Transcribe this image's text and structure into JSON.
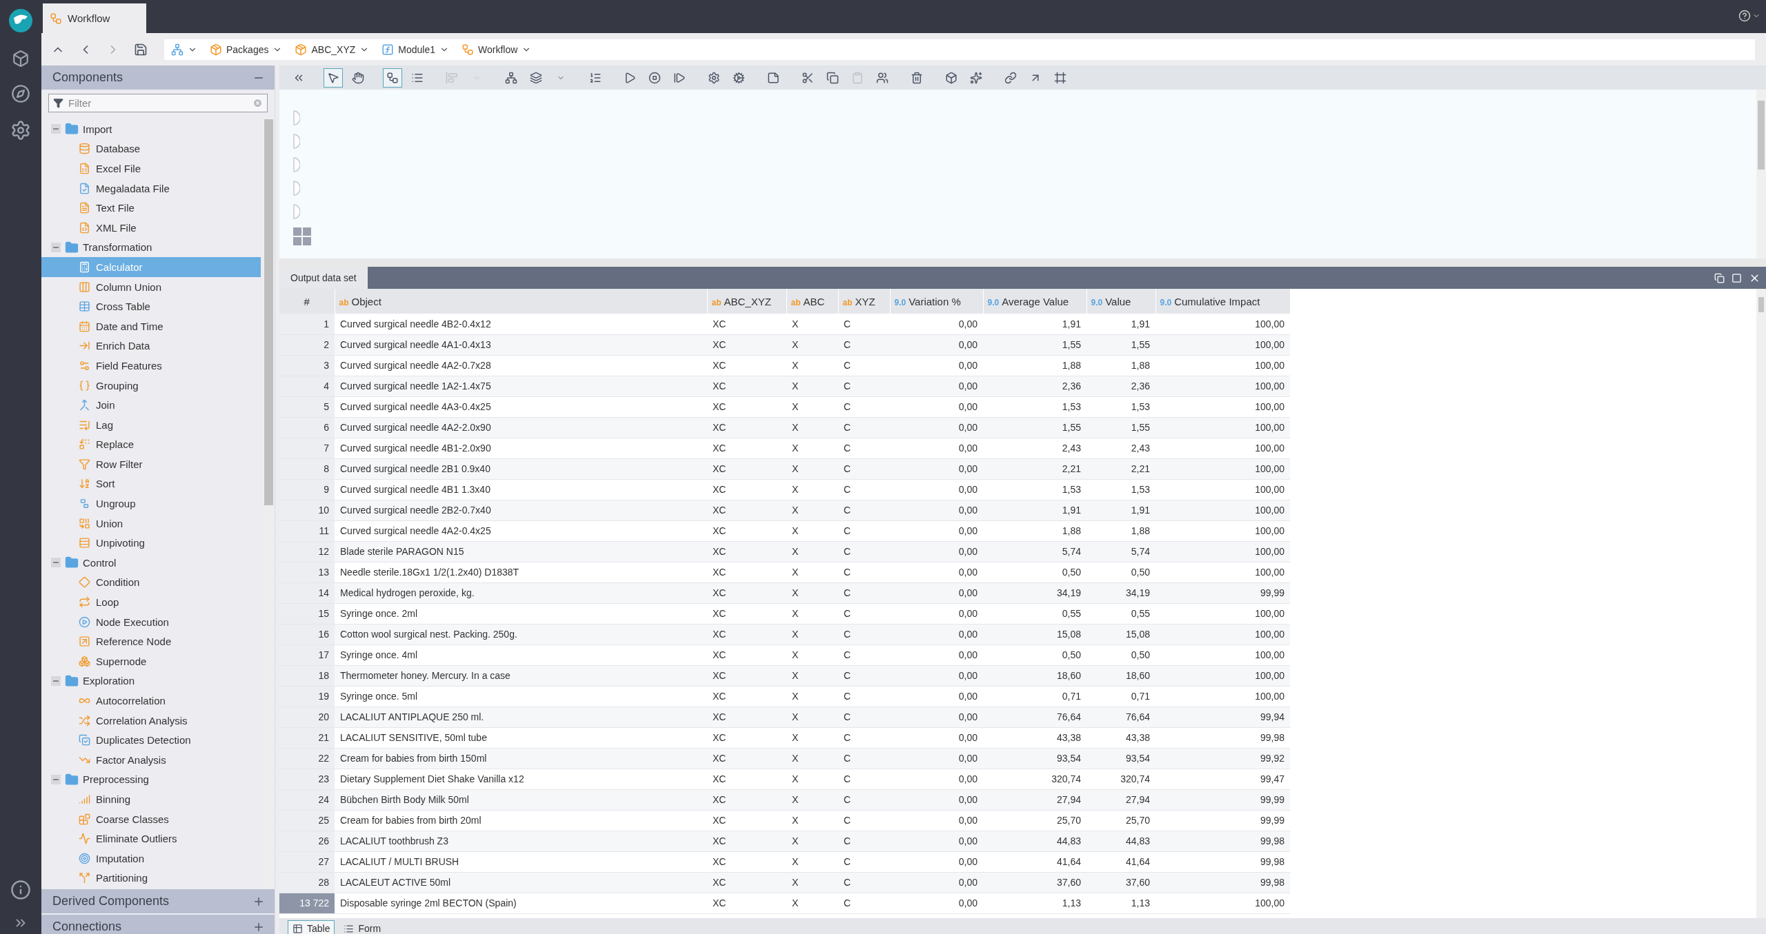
{
  "top_tab": {
    "label": "Workflow"
  },
  "breadcrumb": [
    {
      "label": "Packages"
    },
    {
      "label": "ABC_XYZ"
    },
    {
      "label": "Module1"
    },
    {
      "label": "Workflow"
    }
  ],
  "components": {
    "title": "Components",
    "expanded": true,
    "filter": {
      "placeholder": "Filter"
    },
    "tree": [
      {
        "label": "Import",
        "expanded": true,
        "selected": false,
        "children": [
          {
            "label": "Database",
            "selected": false
          },
          {
            "label": "Excel File",
            "selected": false
          },
          {
            "label": "Megaladata File",
            "selected": false
          },
          {
            "label": "Text File",
            "selected": false
          },
          {
            "label": "XML File",
            "selected": false
          }
        ]
      },
      {
        "label": "Transformation",
        "expanded": true,
        "selected": false,
        "children": [
          {
            "label": "Calculator",
            "selected": true
          },
          {
            "label": "Column Union",
            "selected": false
          },
          {
            "label": "Cross Table",
            "selected": false
          },
          {
            "label": "Date and Time",
            "selected": false
          },
          {
            "label": "Enrich Data",
            "selected": false
          },
          {
            "label": "Field Features",
            "selected": false
          },
          {
            "label": "Grouping",
            "selected": false
          },
          {
            "label": "Join",
            "selected": false
          },
          {
            "label": "Lag",
            "selected": false
          },
          {
            "label": "Replace",
            "selected": false
          },
          {
            "label": "Row Filter",
            "selected": false
          },
          {
            "label": "Sort",
            "selected": false
          },
          {
            "label": "Ungroup",
            "selected": false
          },
          {
            "label": "Union",
            "selected": false
          },
          {
            "label": "Unpivoting",
            "selected": false
          }
        ]
      },
      {
        "label": "Control",
        "expanded": true,
        "selected": false,
        "children": [
          {
            "label": "Condition",
            "selected": false
          },
          {
            "label": "Loop",
            "selected": false
          },
          {
            "label": "Node Execution",
            "selected": false
          },
          {
            "label": "Reference Node",
            "selected": false
          },
          {
            "label": "Supernode",
            "selected": false
          }
        ]
      },
      {
        "label": "Exploration",
        "expanded": true,
        "selected": false,
        "children": [
          {
            "label": "Autocorrelation",
            "selected": false
          },
          {
            "label": "Correlation Analysis",
            "selected": false
          },
          {
            "label": "Duplicates Detection",
            "selected": false
          },
          {
            "label": "Factor Analysis",
            "selected": false
          }
        ]
      },
      {
        "label": "Preprocessing",
        "expanded": true,
        "selected": false,
        "children": [
          {
            "label": "Binning",
            "selected": false
          },
          {
            "label": "Coarse Classes",
            "selected": false
          },
          {
            "label": "Eliminate Outliers",
            "selected": false
          },
          {
            "label": "Imputation",
            "selected": false
          },
          {
            "label": "Partitioning",
            "selected": false
          }
        ]
      }
    ]
  },
  "panels": [
    {
      "title": "Derived Components",
      "expanded": false
    },
    {
      "title": "Connections",
      "expanded": false
    }
  ],
  "toolbar": {
    "groups": [
      [
        {
          "selected": false,
          "disabled": false
        }
      ],
      [
        {
          "selected": true,
          "disabled": false
        },
        {
          "selected": false,
          "disabled": false
        }
      ],
      [
        {
          "selected": true,
          "disabled": false
        },
        {
          "selected": false,
          "disabled": false
        }
      ],
      [
        {
          "selected": false,
          "disabled": true
        },
        {
          "selected": false,
          "disabled": true
        }
      ],
      [
        {
          "selected": false,
          "disabled": false
        },
        {
          "selected": false,
          "disabled": false
        },
        {
          "selected": false,
          "disabled": false
        }
      ],
      [
        {
          "selected": false,
          "disabled": false
        }
      ],
      [
        {
          "selected": false,
          "disabled": false
        },
        {
          "selected": false,
          "disabled": false
        },
        {
          "selected": false,
          "disabled": false
        }
      ],
      [
        {
          "selected": false,
          "disabled": false
        },
        {
          "selected": false,
          "disabled": false
        }
      ],
      [
        {
          "selected": false,
          "disabled": false
        }
      ],
      [
        {
          "selected": false,
          "disabled": false
        },
        {
          "selected": false,
          "disabled": false
        },
        {
          "selected": false,
          "disabled": true
        },
        {
          "selected": false,
          "disabled": false
        }
      ],
      [
        {
          "selected": false,
          "disabled": false
        }
      ],
      [
        {
          "selected": false,
          "disabled": false
        },
        {
          "selected": false,
          "disabled": false
        }
      ],
      [
        {
          "selected": false,
          "disabled": false
        },
        {
          "selected": false,
          "disabled": false
        },
        {
          "selected": false,
          "disabled": false
        }
      ]
    ]
  },
  "output": {
    "tab": {
      "label": "Output data set",
      "selected": true
    },
    "columns": [
      {
        "label": "#"
      },
      {
        "type": "ab",
        "label": "Object"
      },
      {
        "type": "ab",
        "label": "ABC_XYZ"
      },
      {
        "type": "ab",
        "label": "ABC"
      },
      {
        "type": "ab",
        "label": "XYZ"
      },
      {
        "type": "9.0",
        "label": "Variation %"
      },
      {
        "type": "9.0",
        "label": "Average Value"
      },
      {
        "type": "9.0",
        "label": "Value"
      },
      {
        "type": "9.0",
        "label": "Cumulative Impact"
      }
    ],
    "rows": [
      {
        "cells": [
          "1",
          "Curved surgical needle 4B2-0.4x12",
          "XC",
          "X",
          "C",
          "0,00",
          "1,91",
          "1,91",
          "100,00"
        ],
        "selected": false
      },
      {
        "cells": [
          "2",
          "Curved surgical needle 4A1-0.4x13",
          "XC",
          "X",
          "C",
          "0,00",
          "1,55",
          "1,55",
          "100,00"
        ],
        "selected": false
      },
      {
        "cells": [
          "3",
          "Curved surgical needle 4A2-0.7x28",
          "XC",
          "X",
          "C",
          "0,00",
          "1,88",
          "1,88",
          "100,00"
        ],
        "selected": false
      },
      {
        "cells": [
          "4",
          "Curved surgical needle 1A2-1.4x75",
          "XC",
          "X",
          "C",
          "0,00",
          "2,36",
          "2,36",
          "100,00"
        ],
        "selected": false
      },
      {
        "cells": [
          "5",
          "Curved surgical needle 4A3-0.4x25",
          "XC",
          "X",
          "C",
          "0,00",
          "1,53",
          "1,53",
          "100,00"
        ],
        "selected": false
      },
      {
        "cells": [
          "6",
          "Curved surgical needle 4A2-2.0x90",
          "XC",
          "X",
          "C",
          "0,00",
          "1,55",
          "1,55",
          "100,00"
        ],
        "selected": false
      },
      {
        "cells": [
          "7",
          "Curved surgical needle 4B1-2.0x90",
          "XC",
          "X",
          "C",
          "0,00",
          "2,43",
          "2,43",
          "100,00"
        ],
        "selected": false
      },
      {
        "cells": [
          "8",
          "Curved surgical needle 2B1 0.9x40",
          "XC",
          "X",
          "C",
          "0,00",
          "2,21",
          "2,21",
          "100,00"
        ],
        "selected": false
      },
      {
        "cells": [
          "9",
          "Curved surgical needle 4B1 1.3x40",
          "XC",
          "X",
          "C",
          "0,00",
          "1,53",
          "1,53",
          "100,00"
        ],
        "selected": false
      },
      {
        "cells": [
          "10",
          "Curved surgical needle 2B2-0.7x40",
          "XC",
          "X",
          "C",
          "0,00",
          "1,91",
          "1,91",
          "100,00"
        ],
        "selected": false
      },
      {
        "cells": [
          "11",
          "Curved surgical needle 4A2-0.4x25",
          "XC",
          "X",
          "C",
          "0,00",
          "1,88",
          "1,88",
          "100,00"
        ],
        "selected": false
      },
      {
        "cells": [
          "12",
          "Blade sterile PARAGON N15",
          "XC",
          "X",
          "C",
          "0,00",
          "5,74",
          "5,74",
          "100,00"
        ],
        "selected": false
      },
      {
        "cells": [
          "13",
          "Needle sterile.18Gx1 1/2(1.2x40) D1838T",
          "XC",
          "X",
          "C",
          "0,00",
          "0,50",
          "0,50",
          "100,00"
        ],
        "selected": false
      },
      {
        "cells": [
          "14",
          "Medical hydrogen peroxide, kg.",
          "XC",
          "X",
          "C",
          "0,00",
          "34,19",
          "34,19",
          "99,99"
        ],
        "selected": false
      },
      {
        "cells": [
          "15",
          "Syringe once. 2ml",
          "XC",
          "X",
          "C",
          "0,00",
          "0,55",
          "0,55",
          "100,00"
        ],
        "selected": false
      },
      {
        "cells": [
          "16",
          "Cotton wool surgical nest. Packing. 250g.",
          "XC",
          "X",
          "C",
          "0,00",
          "15,08",
          "15,08",
          "100,00"
        ],
        "selected": false
      },
      {
        "cells": [
          "17",
          "Syringe once. 4ml",
          "XC",
          "X",
          "C",
          "0,00",
          "0,50",
          "0,50",
          "100,00"
        ],
        "selected": false
      },
      {
        "cells": [
          "18",
          "Thermometer honey. Mercury. In a case",
          "XC",
          "X",
          "C",
          "0,00",
          "18,60",
          "18,60",
          "100,00"
        ],
        "selected": false
      },
      {
        "cells": [
          "19",
          "Syringe once. 5ml",
          "XC",
          "X",
          "C",
          "0,00",
          "0,71",
          "0,71",
          "100,00"
        ],
        "selected": false
      },
      {
        "cells": [
          "20",
          "LACALIUT ANTIPLAQUE 250 ml.",
          "XC",
          "X",
          "C",
          "0,00",
          "76,64",
          "76,64",
          "99,94"
        ],
        "selected": false
      },
      {
        "cells": [
          "21",
          "LACALIUT SENSITIVE, 50ml tube",
          "XC",
          "X",
          "C",
          "0,00",
          "43,38",
          "43,38",
          "99,98"
        ],
        "selected": false
      },
      {
        "cells": [
          "22",
          "Cream for babies from birth 150ml",
          "XC",
          "X",
          "C",
          "0,00",
          "93,54",
          "93,54",
          "99,92"
        ],
        "selected": false
      },
      {
        "cells": [
          "23",
          "Dietary Supplement Diet Shake Vanilla x12",
          "XC",
          "X",
          "C",
          "0,00",
          "320,74",
          "320,74",
          "99,47"
        ],
        "selected": false
      },
      {
        "cells": [
          "24",
          "Bübchen Birth Body Milk 50ml",
          "XC",
          "X",
          "C",
          "0,00",
          "27,94",
          "27,94",
          "99,99"
        ],
        "selected": false
      },
      {
        "cells": [
          "25",
          "Cream for babies from birth 20ml",
          "XC",
          "X",
          "C",
          "0,00",
          "25,70",
          "25,70",
          "99,99"
        ],
        "selected": false
      },
      {
        "cells": [
          "26",
          "LACALIUT toothbrush Z3",
          "XC",
          "X",
          "C",
          "0,00",
          "44,83",
          "44,83",
          "99,98"
        ],
        "selected": false
      },
      {
        "cells": [
          "27",
          "LACALIUT / MULTI BRUSH",
          "XC",
          "X",
          "C",
          "0,00",
          "41,64",
          "41,64",
          "99,98"
        ],
        "selected": false
      },
      {
        "cells": [
          "28",
          "LACALEUT ACTIVE 50ml",
          "XC",
          "X",
          "C",
          "0,00",
          "37,60",
          "37,60",
          "99,98"
        ],
        "selected": false
      },
      {
        "cells": [
          "13 722",
          "Disposable syringe 2ml BECTON (Spain)",
          "XC",
          "X",
          "C",
          "0,00",
          "1,13",
          "1,13",
          "100,00"
        ],
        "selected": true
      }
    ],
    "view_tabs": [
      {
        "label": "Table",
        "selected": true
      },
      {
        "label": "Form",
        "selected": false
      }
    ]
  }
}
